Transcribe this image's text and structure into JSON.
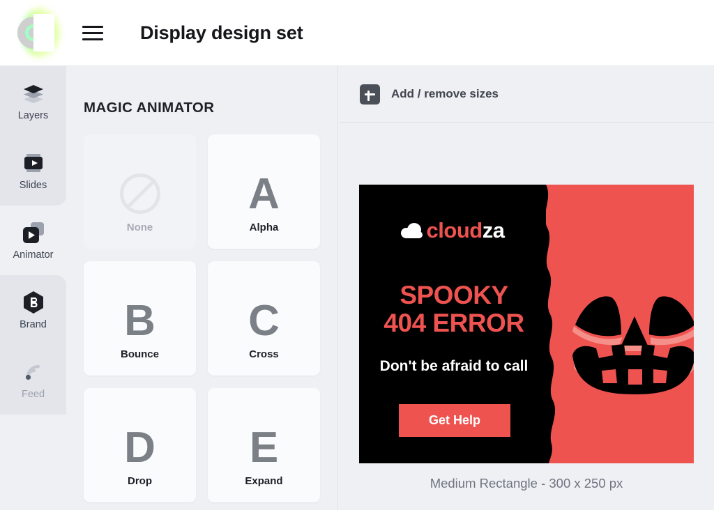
{
  "header": {
    "logo_icon": "cloudza-ring-logo",
    "menu_icon": "hamburger-menu-icon",
    "title": "Display design set"
  },
  "sidebar": {
    "items": [
      {
        "label": "Layers",
        "icon": "layers-icon",
        "active": false,
        "disabled": false
      },
      {
        "label": "Slides",
        "icon": "slides-icon",
        "active": false,
        "disabled": false
      },
      {
        "label": "Animator",
        "icon": "animator-icon",
        "active": true,
        "disabled": false
      },
      {
        "label": "Brand",
        "icon": "brand-hexagon-icon",
        "active": false,
        "disabled": false
      },
      {
        "label": "Feed",
        "icon": "rss-feed-icon",
        "active": false,
        "disabled": true
      }
    ]
  },
  "panel": {
    "title": "MAGIC ANIMATOR",
    "animations": [
      {
        "glyph": "",
        "label": "None",
        "icon": "no-entry-icon",
        "selected": false
      },
      {
        "glyph": "A",
        "label": "Alpha",
        "icon": "",
        "selected": false
      },
      {
        "glyph": "B",
        "label": "Bounce",
        "icon": "",
        "selected": false
      },
      {
        "glyph": "C",
        "label": "Cross",
        "icon": "",
        "selected": false
      },
      {
        "glyph": "D",
        "label": "Drop",
        "icon": "",
        "selected": false
      },
      {
        "glyph": "E",
        "label": "Expand",
        "icon": "",
        "selected": false
      }
    ]
  },
  "canvas": {
    "add_remove_icon": "plus-icon",
    "add_remove_label": "Add / remove sizes",
    "ad": {
      "brand_cloud": "cloud",
      "brand_suffix": "za",
      "headline_line1": "SPOOKY",
      "headline_line2": "404 ERROR",
      "subhead": "Don't be afraid to call",
      "cta_label": "Get Help",
      "bg_dark": "#000000",
      "accent": "#ef5350",
      "pumpkin_icon": "jack-o-lantern-face-icon"
    },
    "size_caption": "Medium Rectangle - 300 x 250 px"
  }
}
